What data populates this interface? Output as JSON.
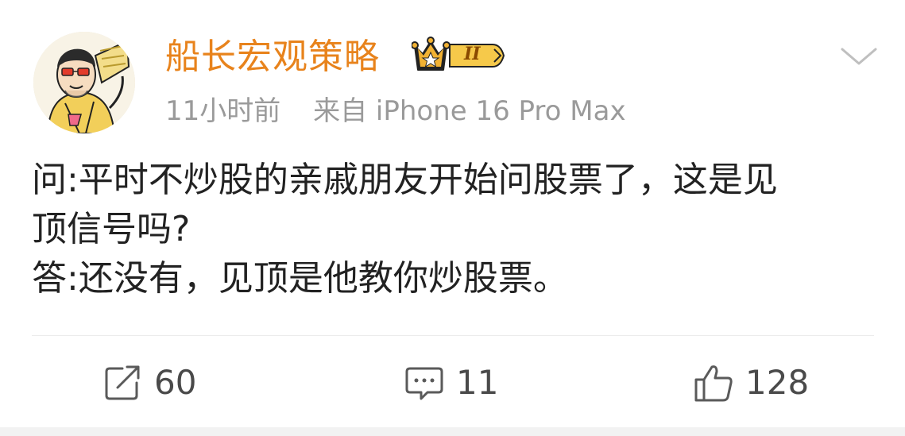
{
  "post": {
    "author": "船长宏观策略",
    "vip_level": "II",
    "time": "11小时前",
    "source": "来自 iPhone 16 Pro Max",
    "content_lines": [
      "问:平时不炒股的亲戚朋友开始问股票了，这是见",
      "顶信号吗?",
      "答:还没有，见顶是他教你炒股票。"
    ]
  },
  "actions": {
    "repost_count": "60",
    "comment_count": "11",
    "like_count": "128"
  },
  "icons": {
    "avatar": "cartoon-man-avatar",
    "badge": "crown-vip-badge-icon",
    "more": "chevron-down-icon",
    "repost": "share-icon",
    "comment": "comment-icon",
    "like": "thumbs-up-icon"
  },
  "colors": {
    "username": "#e8831c",
    "meta_text": "#9a9a9a",
    "content_text": "#222222",
    "badge_gold": "#f2b233"
  }
}
